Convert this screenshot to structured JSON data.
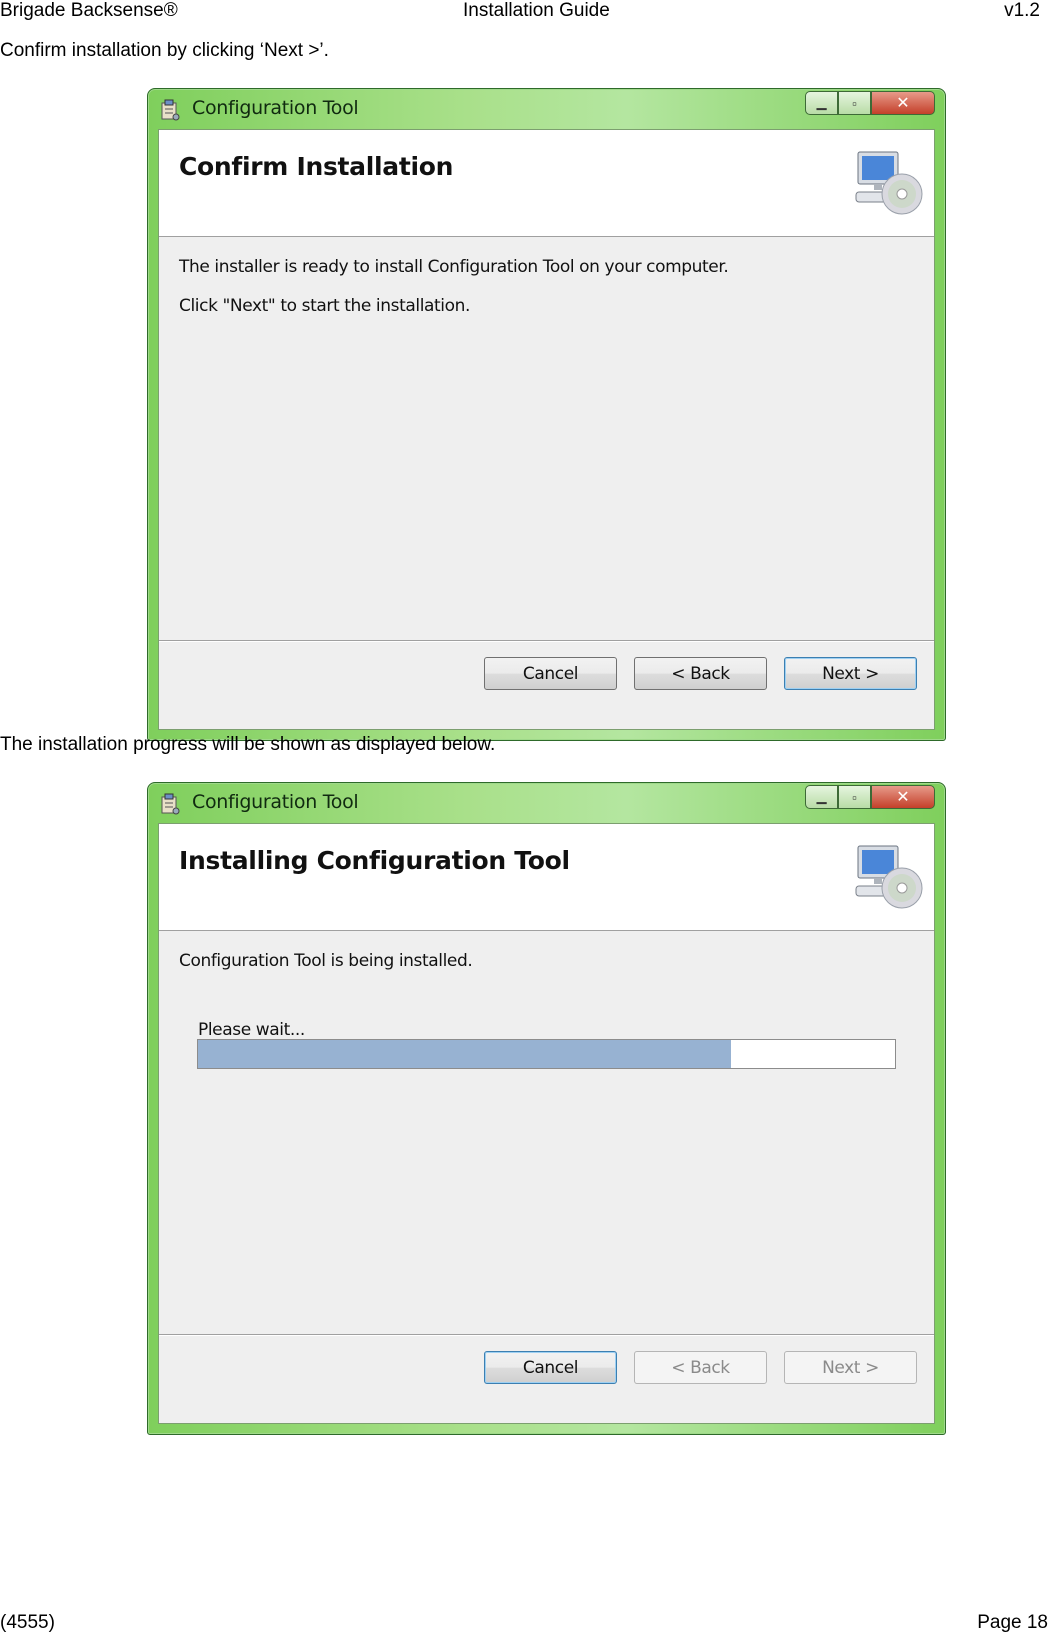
{
  "page_header": {
    "left": "Brigade Backsense®",
    "center": "Installation Guide",
    "right": "v1.2"
  },
  "page_footer": {
    "left": "(4555)",
    "right": "Page 18"
  },
  "instructions": [
    "Confirm installation by clicking ‘Next >’.",
    "The installation progress will be shown as displayed below."
  ],
  "confirm_dialog": {
    "window_title": "Configuration Tool",
    "banner_title": "Confirm Installation",
    "lines": [
      "The installer is ready to install Configuration Tool on your computer.",
      "Click \"Next\" to start the installation."
    ],
    "buttons": {
      "cancel": "Cancel",
      "back": "< Back",
      "next": "Next >"
    }
  },
  "installing_dialog": {
    "window_title": "Configuration Tool",
    "banner_title": "Installing Configuration Tool",
    "status": "Configuration Tool is being installed.",
    "progress_label": "Please wait...",
    "progress_fraction": 0.765,
    "buttons": {
      "cancel": "Cancel",
      "back": "< Back",
      "next": "Next >"
    }
  },
  "colors": {
    "title_bar_green": "#7fcf5c",
    "progress_fill": "#97b2d2",
    "default_button_border": "#3c7fb1"
  },
  "icons": [
    "installer-app-icon",
    "computer-cd-icon",
    "minimize-icon",
    "maximize-icon",
    "close-icon"
  ]
}
